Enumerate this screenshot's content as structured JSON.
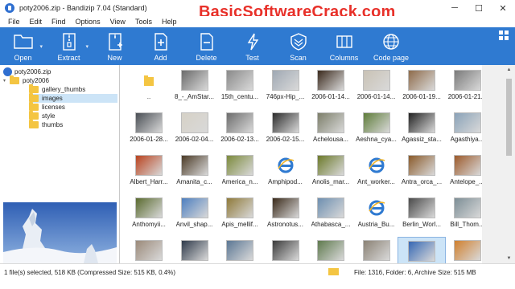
{
  "window": {
    "title": "poty2006.zip - Bandizip 7.04 (Standard)",
    "watermark": "BasicSoftwareCrack.com",
    "controls": [
      "─",
      "☐",
      "✕"
    ]
  },
  "menu": [
    "File",
    "Edit",
    "Find",
    "Options",
    "View",
    "Tools",
    "Help"
  ],
  "toolbar": {
    "buttons": [
      {
        "label": "Open",
        "icon": "open-folder-icon"
      },
      {
        "label": "Extract",
        "icon": "extract-zip-icon"
      },
      {
        "label": "New",
        "icon": "new-archive-icon"
      },
      {
        "label": "Add",
        "icon": "add-file-icon"
      },
      {
        "label": "Delete",
        "icon": "delete-file-icon"
      },
      {
        "label": "Test",
        "icon": "test-lightning-icon"
      },
      {
        "label": "Scan",
        "icon": "scan-shield-icon"
      },
      {
        "label": "Columns",
        "icon": "columns-icon"
      },
      {
        "label": "Code page",
        "icon": "code-page-globe-icon"
      }
    ]
  },
  "tree": {
    "root": "poty2006.zip",
    "folder": "poty2006",
    "children": [
      "gallery_thumbs",
      "images",
      "licenses",
      "style",
      "thumbs"
    ],
    "selected": "images"
  },
  "files": [
    {
      "name": "..",
      "kind": "up",
      "color": "#f4c542"
    },
    {
      "name": "8_-_AmStar...",
      "kind": "img",
      "color": "#6b6b6b"
    },
    {
      "name": "15th_centu...",
      "kind": "img",
      "color": "#8a8a8a"
    },
    {
      "name": "746px-Hip_...",
      "kind": "img",
      "color": "#9fa8b3"
    },
    {
      "name": "2006-01-14...",
      "kind": "img",
      "color": "#3b2a1d"
    },
    {
      "name": "2006-01-14...",
      "kind": "img",
      "color": "#c9c2b5"
    },
    {
      "name": "2006-01-19...",
      "kind": "img",
      "color": "#8e6b4a"
    },
    {
      "name": "2006-01-21...",
      "kind": "img",
      "color": "#7a7a7a"
    },
    {
      "name": "2006-01-28...",
      "kind": "img",
      "color": "#4a4f55"
    },
    {
      "name": "2006-02-04...",
      "kind": "img",
      "color": "#d6d1c6"
    },
    {
      "name": "2006-02-13...",
      "kind": "img",
      "color": "#6d6d6d"
    },
    {
      "name": "2006-02-15...",
      "kind": "img",
      "color": "#2c2c2c"
    },
    {
      "name": "Achelousa...",
      "kind": "img",
      "color": "#7d7f6a"
    },
    {
      "name": "Aeshna_cya...",
      "kind": "img",
      "color": "#5f7d3a"
    },
    {
      "name": "Agassiz_sta...",
      "kind": "img",
      "color": "#222222"
    },
    {
      "name": "Agasthiya...",
      "kind": "img",
      "color": "#8aa2b8"
    },
    {
      "name": "Albert_Harr...",
      "kind": "img",
      "color": "#b9421e"
    },
    {
      "name": "Amanita_c...",
      "kind": "img",
      "color": "#4b3a26"
    },
    {
      "name": "America_n...",
      "kind": "img",
      "color": "#7c8a3c"
    },
    {
      "name": "Amphipod...",
      "kind": "ie",
      "color": "#2f7ad1"
    },
    {
      "name": "Anolis_mar...",
      "kind": "img",
      "color": "#6c7a2a"
    },
    {
      "name": "Ant_worker...",
      "kind": "ie",
      "color": "#2f7ad1"
    },
    {
      "name": "Antra_orca_...",
      "kind": "img",
      "color": "#8a5a2a"
    },
    {
      "name": "Antelope_...",
      "kind": "img",
      "color": "#9c5a2b"
    },
    {
      "name": "Anthomyii...",
      "kind": "img",
      "color": "#5a6b2f"
    },
    {
      "name": "Anvil_shap...",
      "kind": "img",
      "color": "#4d7fbf"
    },
    {
      "name": "Apis_mellif...",
      "kind": "img",
      "color": "#8f7a3a"
    },
    {
      "name": "Astronotus...",
      "kind": "img",
      "color": "#3a2a1a"
    },
    {
      "name": "Athabasca_...",
      "kind": "img",
      "color": "#6e8fb0"
    },
    {
      "name": "Austria_Bu...",
      "kind": "ie",
      "color": "#2f7ad1"
    },
    {
      "name": "Berlin_Worl...",
      "kind": "img",
      "color": "#4a4a4a"
    },
    {
      "name": "Bill_Thom...",
      "kind": "img",
      "color": "#7d8e96"
    },
    {
      "name": "Bismuth_cr...",
      "kind": "img",
      "color": "#9b8a7a"
    },
    {
      "name": "Black-head...",
      "kind": "img",
      "color": "#2f3a4a"
    },
    {
      "name": "Boelge_sto...",
      "kind": "img",
      "color": "#5b7794"
    },
    {
      "name": "Brazilian_N...",
      "kind": "img",
      "color": "#3b3b3b"
    },
    {
      "name": "Bridge_Alc...",
      "kind": "img",
      "color": "#5f7a4e"
    },
    {
      "name": "British_Mus...",
      "kind": "img",
      "color": "#8b8275"
    },
    {
      "name": "BrockenSnowedTreesInSun.jpg",
      "kind": "img",
      "color": "#3567b4",
      "selected": true
    },
    {
      "name": "Brooklyn_B...",
      "kind": "img",
      "color": "#d0802e"
    }
  ],
  "status": {
    "left": "1 file(s) selected, 518 KB (Compressed Size: 515 KB, 0.4%)",
    "right": "File: 1316, Folder: 6, Archive Size: 515 MB"
  }
}
